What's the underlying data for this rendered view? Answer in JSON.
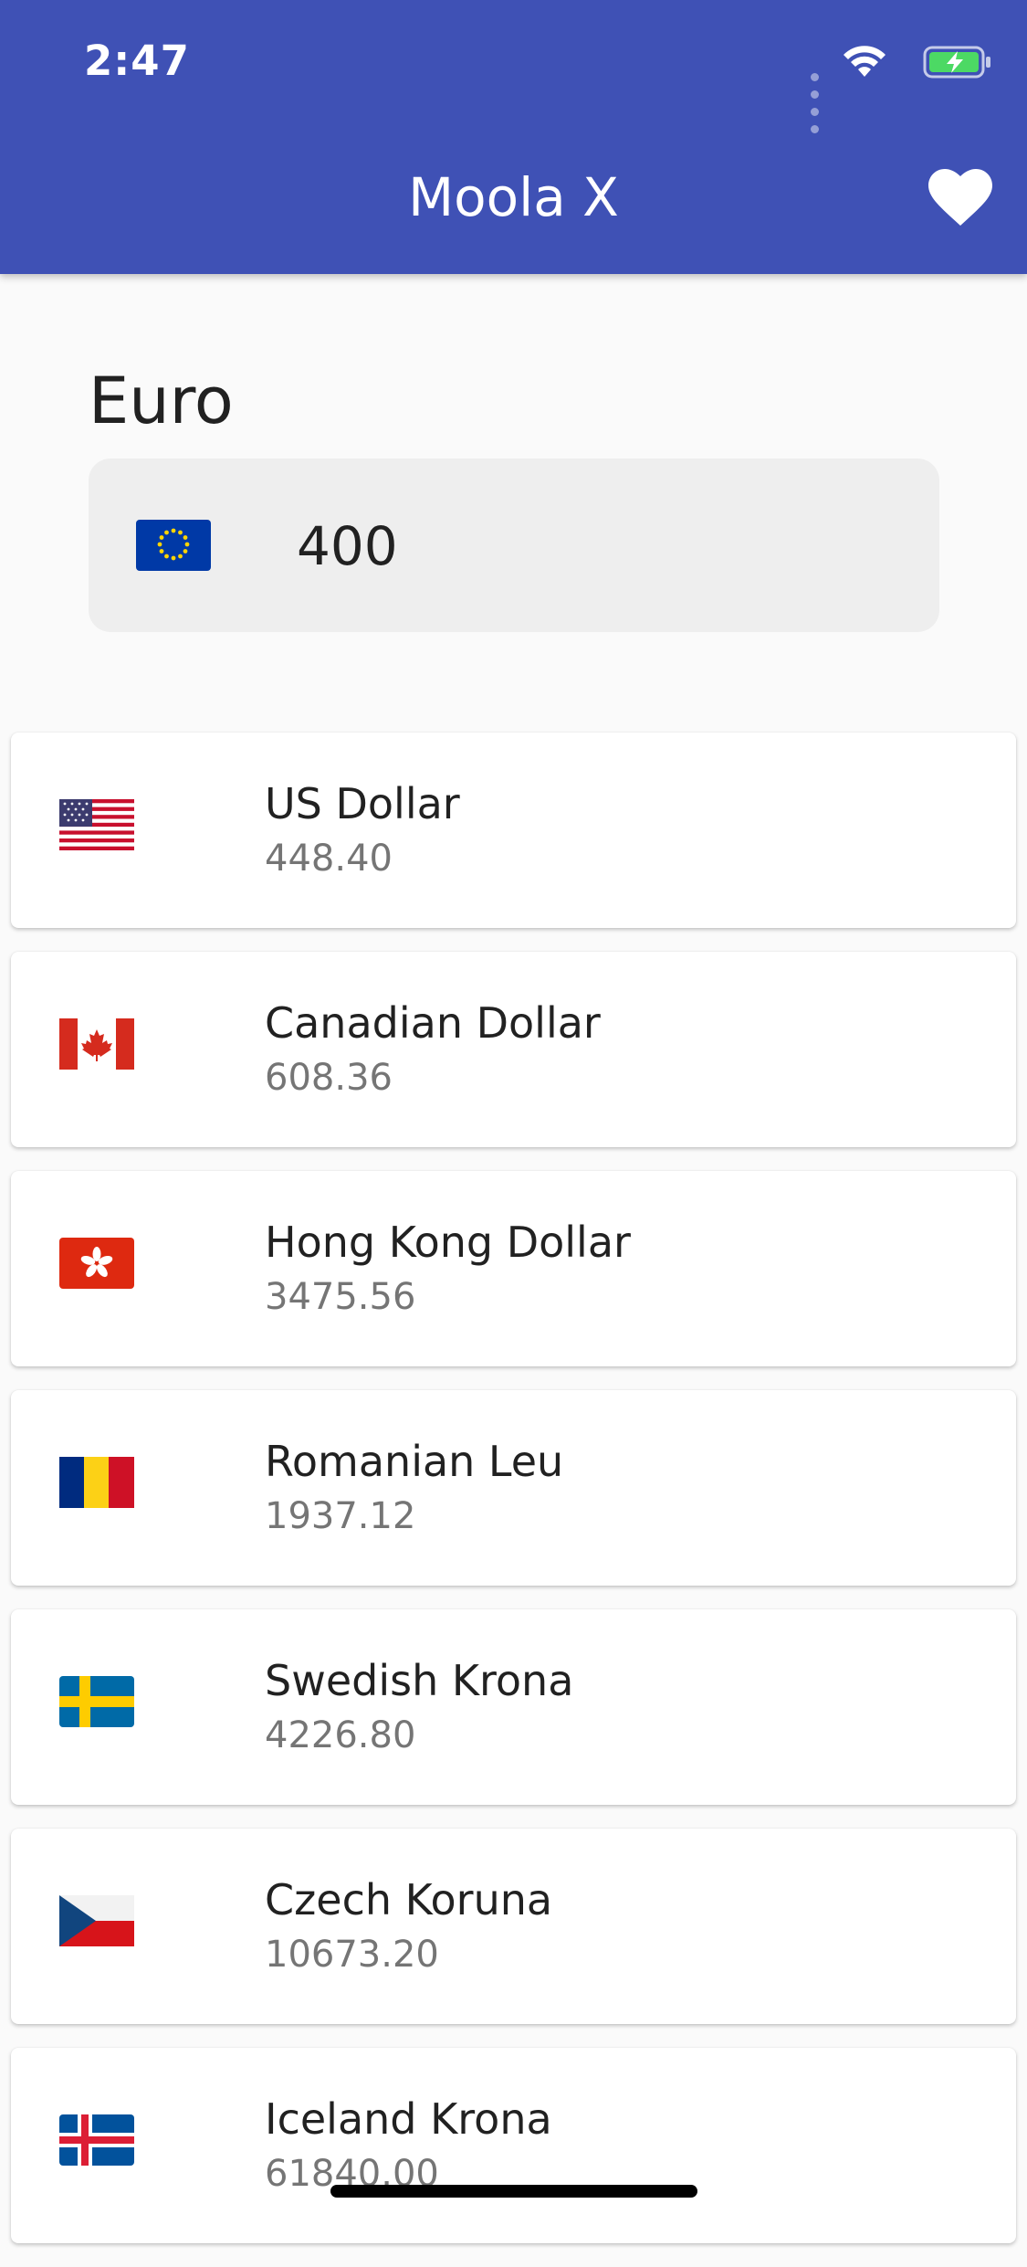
{
  "status_bar": {
    "time": "2:47",
    "signal_icon": "signal-dots-icon",
    "wifi_icon": "wifi-icon",
    "battery_icon": "battery-charging-icon"
  },
  "app_bar": {
    "title": "Moola X",
    "action_icon": "heart-icon",
    "color": "#3f51b5"
  },
  "base_currency": {
    "name": "Euro",
    "flag": "eu-flag-icon",
    "amount": "400"
  },
  "currencies": [
    {
      "name": "US Dollar",
      "value": "448.40",
      "flag": "us-flag-icon"
    },
    {
      "name": "Canadian Dollar",
      "value": "608.36",
      "flag": "canada-flag-icon"
    },
    {
      "name": "Hong Kong Dollar",
      "value": "3475.56",
      "flag": "hong-kong-flag-icon"
    },
    {
      "name": "Romanian Leu",
      "value": "1937.12",
      "flag": "romania-flag-icon"
    },
    {
      "name": "Swedish Krona",
      "value": "4226.80",
      "flag": "sweden-flag-icon"
    },
    {
      "name": "Czech Koruna",
      "value": "10673.20",
      "flag": "czech-flag-icon"
    },
    {
      "name": "Iceland Krona",
      "value": "61840.00",
      "flag": "iceland-flag-icon"
    }
  ]
}
